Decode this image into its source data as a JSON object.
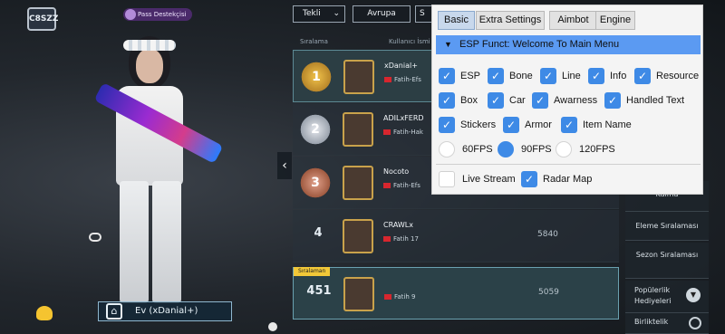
{
  "game": {
    "logo_text": "C8SZZ",
    "pass_label": "Pass Destekçisi",
    "mode_select": "Tekli",
    "region_button": "Avrupa",
    "home_label": "Ev (xDanial+)",
    "columns": {
      "rank": "Sıralama",
      "player": "Kullanıcı İsmi"
    },
    "rows": [
      {
        "rank": "1",
        "name": "xDanial+",
        "clan": "Fatih-Efs",
        "score": ""
      },
      {
        "rank": "2",
        "name": "ADILxFERD",
        "clan": "Fatih-Hak",
        "score": ""
      },
      {
        "rank": "3",
        "name": "Nocoto",
        "clan": "Fatih-Efs",
        "score": ""
      },
      {
        "rank": "4",
        "name": "CRAWLx",
        "clan": "Fatih 17",
        "score": "5840"
      },
      {
        "rank": "451",
        "name": "",
        "clan": "Fatih 9",
        "score": "5059",
        "tag": "Sıralaman"
      }
    ],
    "side_nav": [
      "Kalma",
      "Eleme Sıralaması",
      "Sezon Sıralaması",
      "Popülerlik Hediyeleri",
      "Birliktelik"
    ]
  },
  "menu": {
    "tabs": [
      "Basic",
      "Extra Settings",
      "Aimbot",
      "Engine"
    ],
    "active_tab": "Basic",
    "header": "ESP Funct: Welcome To Main Menu",
    "row1": [
      "ESP",
      "Bone",
      "Line",
      "Info",
      "Resource"
    ],
    "row2": [
      "Box",
      "Car",
      "Awarness",
      "Handled Text"
    ],
    "row3": [
      "Stickers",
      "Armor",
      "Item Name"
    ],
    "fps": {
      "options": [
        "60FPS",
        "90FPS",
        "120FPS"
      ],
      "selected": "90FPS"
    },
    "live_stream": {
      "label": "Live Stream",
      "checked": false
    },
    "radar_map": {
      "label": "Radar Map",
      "checked": true
    },
    "accent_color": "#3e8ae6",
    "header_color": "#5b9af2"
  }
}
